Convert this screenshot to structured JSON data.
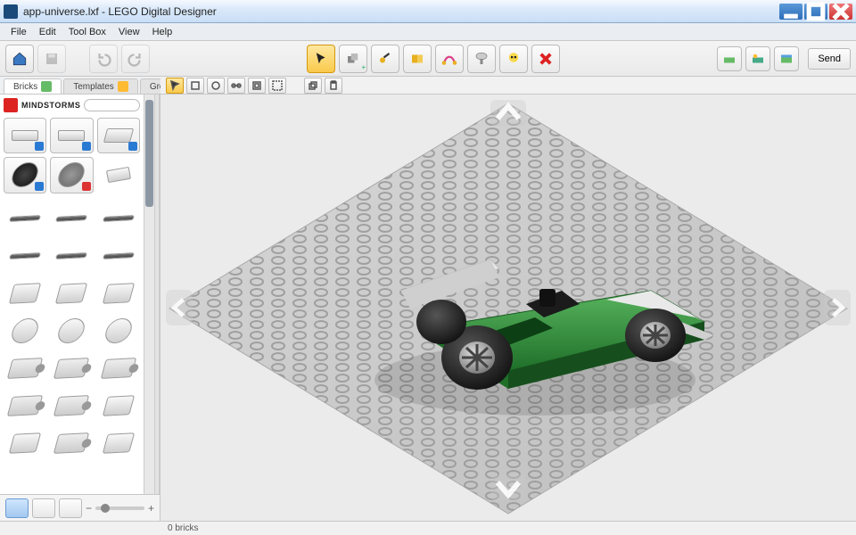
{
  "window": {
    "title": "app-universe.lxf - LEGO Digital Designer"
  },
  "menubar": {
    "items": [
      "File",
      "Edit",
      "Tool Box",
      "View",
      "Help"
    ]
  },
  "toolbar": {
    "home": "home",
    "save": "save",
    "undo": "undo",
    "redo": "redo",
    "tools": [
      "select",
      "clone",
      "hinge",
      "hinge-align",
      "flex",
      "paint",
      "hide",
      "delete"
    ],
    "right_mode_icons": [
      "mode-build",
      "mode-view",
      "mode-guide"
    ],
    "send_label": "Send"
  },
  "subtoolbar": {
    "groupA": [
      "sel-single",
      "sel-color",
      "sel-shape",
      "sel-connected",
      "sel-invert",
      "sel-all"
    ],
    "groupB": [
      "copy",
      "paste"
    ]
  },
  "sidebar": {
    "tabs": [
      {
        "label": "Bricks",
        "active": true
      },
      {
        "label": "Templates",
        "active": false
      },
      {
        "label": "Groups",
        "active": false
      }
    ],
    "brand": "MINDSTORMS",
    "filter_placeholder": "",
    "footer_views": [
      "grid-view",
      "divided-view",
      "list-view"
    ]
  },
  "status": {
    "bricks_label": "0 bricks"
  },
  "colors": {
    "accent": "#f9c94b",
    "car_body": "#2e8f3a",
    "car_trim": "#e9e9e9",
    "wheel": "#222"
  }
}
